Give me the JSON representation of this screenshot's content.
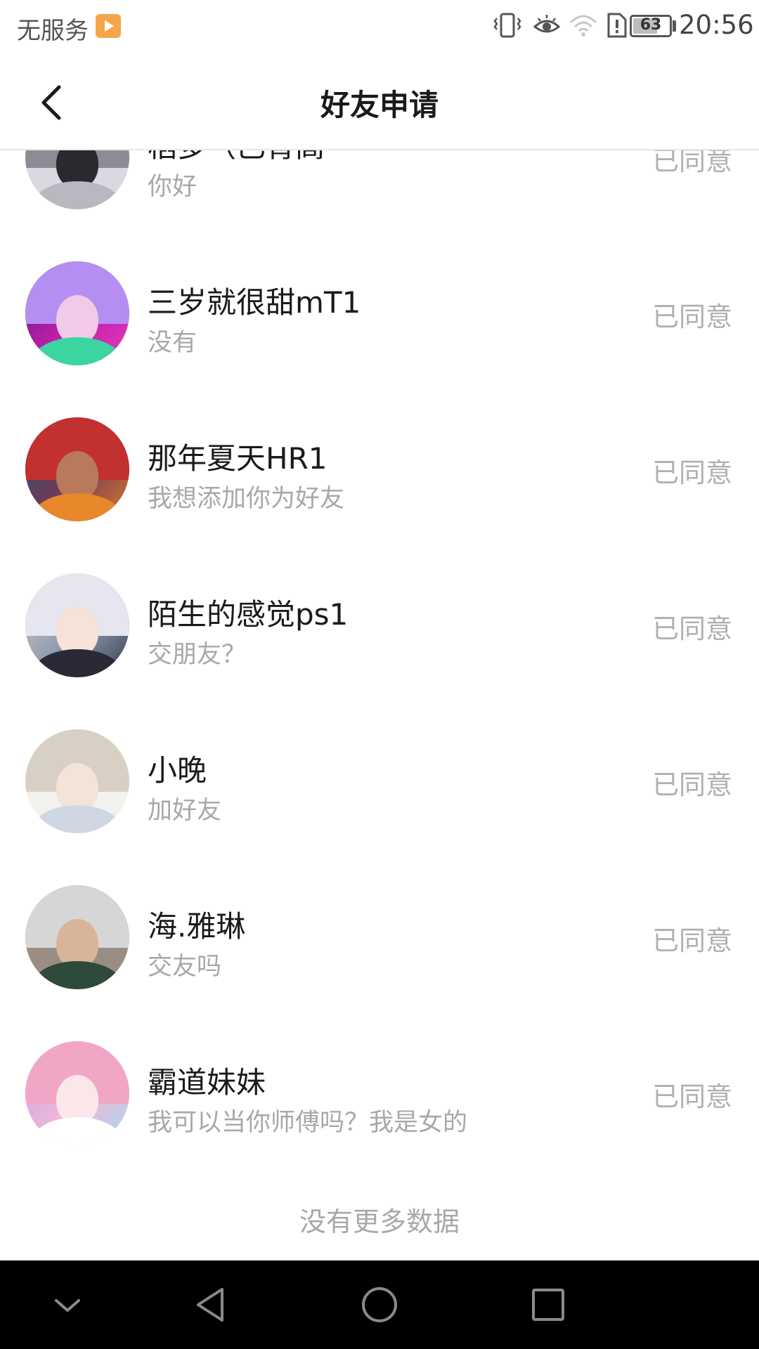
{
  "status_bar": {
    "carrier": "无服务",
    "battery": "63",
    "time": "20:56",
    "icons": [
      "vibrate-icon",
      "eye-comfort-icon",
      "wifi-icon",
      "sim-alert-icon",
      "battery-icon"
    ]
  },
  "header": {
    "title": "好友申请",
    "back_icon": "chevron-left-icon"
  },
  "requests": [
    {
      "name": "稻多（已青高",
      "message": "你好",
      "status": "已同意"
    },
    {
      "name": "三岁就很甜mT1",
      "message": "没有",
      "status": "已同意"
    },
    {
      "name": "那年夏天HR1",
      "message": "我想添加你为好友",
      "status": "已同意"
    },
    {
      "name": "陌生的感觉ps1",
      "message": "交朋友？",
      "status": "已同意"
    },
    {
      "name": "小晚",
      "message": "加好友",
      "status": "已同意"
    },
    {
      "name": "海.雅琳",
      "message": "交友吗",
      "status": "已同意"
    },
    {
      "name": "霸道妹妹",
      "message": "我可以当你师傅吗？我是女的",
      "status": "已同意"
    }
  ],
  "footer_text": "没有更多数据",
  "nav_bar": {
    "icons": [
      "nav-hide-icon",
      "nav-back-icon",
      "nav-home-icon",
      "nav-recents-icon"
    ]
  },
  "colors": {
    "title": "#1a1a1a",
    "secondary_text": "#a8a8a8",
    "status_text": "#b0b0b0",
    "nav_bar": "#000000"
  }
}
